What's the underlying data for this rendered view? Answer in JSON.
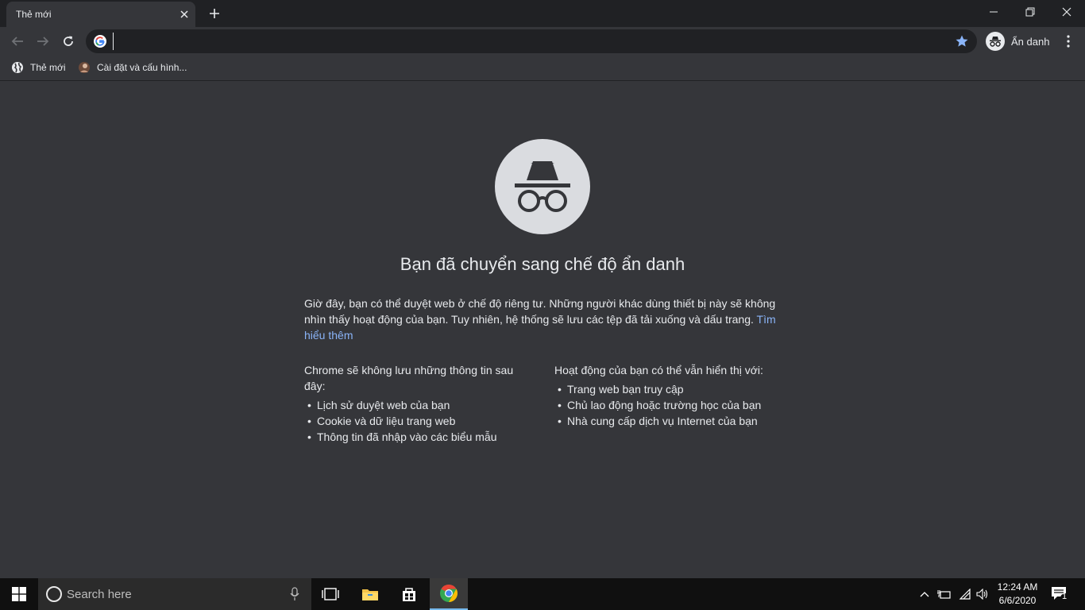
{
  "browser": {
    "tab_title": "Thẻ mới",
    "omnibox_value": "",
    "profile_label": "Ẩn danh",
    "colors": {
      "frame": "#202124",
      "toolbar": "#35363a",
      "link": "#8ab4f8",
      "star": "#8ab4f8"
    }
  },
  "bookmarks": [
    {
      "label": "Thẻ mới",
      "icon": "globe-icon"
    },
    {
      "label": "Cài đặt và cấu hình...",
      "icon": "avatar-icon"
    }
  ],
  "incognito": {
    "heading": "Bạn đã chuyển sang chế độ ẩn danh",
    "paragraph": "Giờ đây, bạn có thể duyệt web ở chế độ riêng tư. Những người khác dùng thiết bị này sẽ không nhìn thấy hoạt động của bạn. Tuy nhiên, hệ thống sẽ lưu các tệp đã tải xuống và dấu trang.",
    "learn_more": "Tìm hiểu thêm",
    "left_column": {
      "title": "Chrome sẽ không lưu những thông tin sau đây:",
      "items": [
        "Lịch sử duyệt web của bạn",
        "Cookie và dữ liệu trang web",
        "Thông tin đã nhập vào các biểu mẫu"
      ]
    },
    "right_column": {
      "title": "Hoạt động của bạn có thể vẫn hiển thị với:",
      "items": [
        "Trang web bạn truy cập",
        "Chủ lao động hoặc trường học của bạn",
        "Nhà cung cấp dịch vụ Internet của bạn"
      ]
    }
  },
  "taskbar": {
    "search_placeholder": "Search here",
    "time": "12:24 AM",
    "date": "6/6/2020",
    "notification_count": "1"
  }
}
